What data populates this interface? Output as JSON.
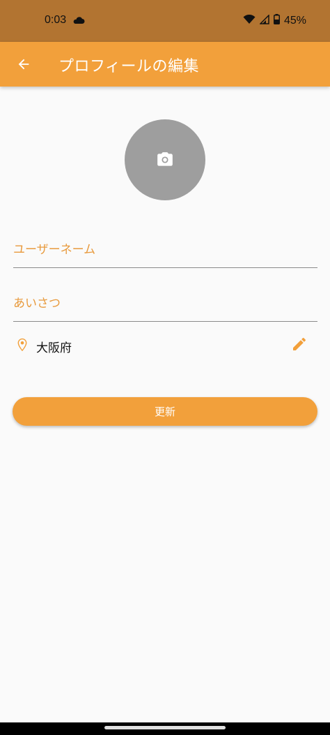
{
  "status_bar": {
    "time": "0:03",
    "battery": "45%",
    "icons": [
      "cloud-icon",
      "wifi-icon",
      "signal-icon",
      "battery-icon"
    ]
  },
  "app_bar": {
    "title": "プロフィールの編集",
    "back_icon": "arrow-back-icon"
  },
  "profile": {
    "avatar_icon": "camera-icon",
    "username_placeholder": "ユーザーネーム",
    "greeting_placeholder": "あいさつ",
    "location": "大阪府",
    "location_icon": "map-pin-icon",
    "edit_icon": "pencil-icon"
  },
  "actions": {
    "update_label": "更新"
  },
  "colors": {
    "accent": "#f2a03b",
    "status_bar": "#b27431",
    "avatar_bg": "#9e9e9e",
    "background": "#fafafa"
  }
}
